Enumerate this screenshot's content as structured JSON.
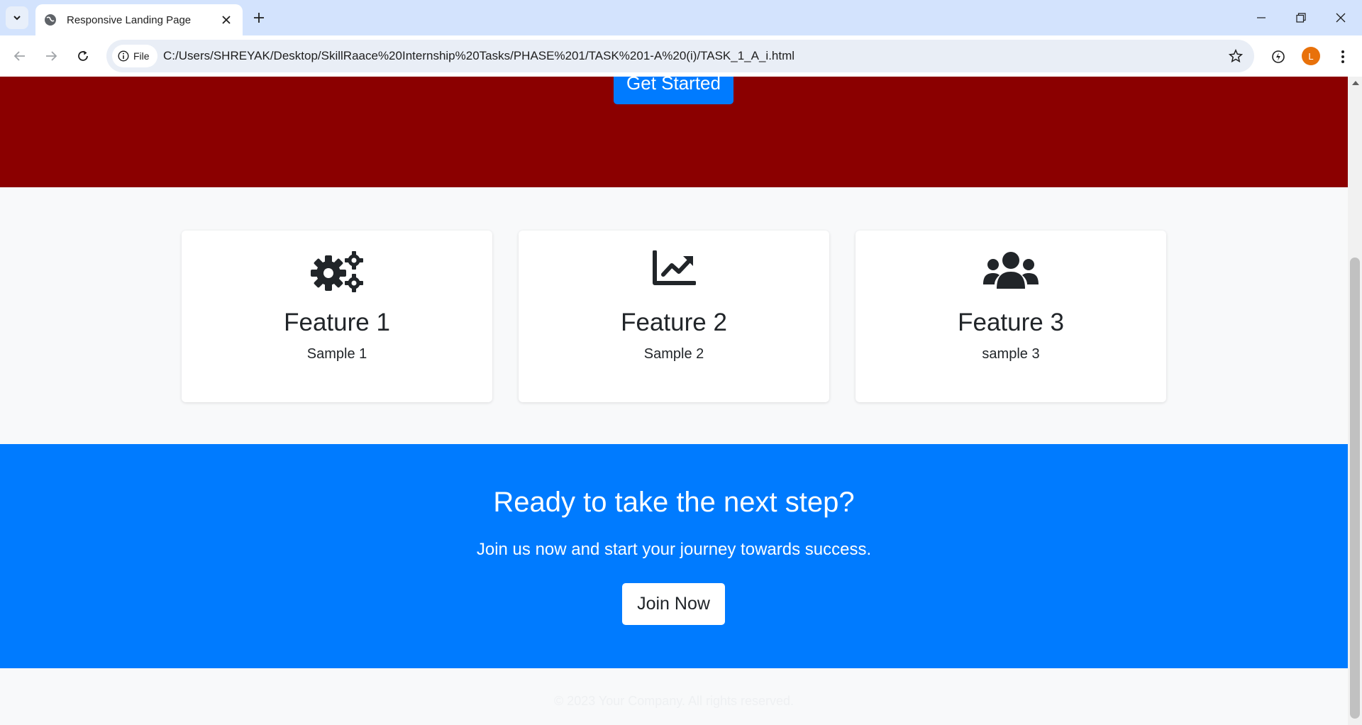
{
  "browser": {
    "tab_title": "Responsive Landing Page",
    "security_chip": "File",
    "url": "C:/Users/SHREYAK/Desktop/SkillRaace%20Internship%20Tasks/PHASE%201/TASK%201-A%20(i)/TASK_1_A_i.html",
    "avatar_letter": "L"
  },
  "hero": {
    "button_label": "Get Started",
    "background_color": "#8b0000"
  },
  "features": [
    {
      "icon": "gears-icon",
      "title": "Feature 1",
      "text": "Sample 1"
    },
    {
      "icon": "chart-line-icon",
      "title": "Feature 2",
      "text": "Sample 2"
    },
    {
      "icon": "users-icon",
      "title": "Feature 3",
      "text": "sample 3"
    }
  ],
  "cta": {
    "heading": "Ready to take the next step?",
    "text": "Join us now and start your journey towards success.",
    "button_label": "Join Now",
    "background_color": "#007bff"
  },
  "footer": {
    "text": "© 2023 Your Company. All rights reserved."
  }
}
